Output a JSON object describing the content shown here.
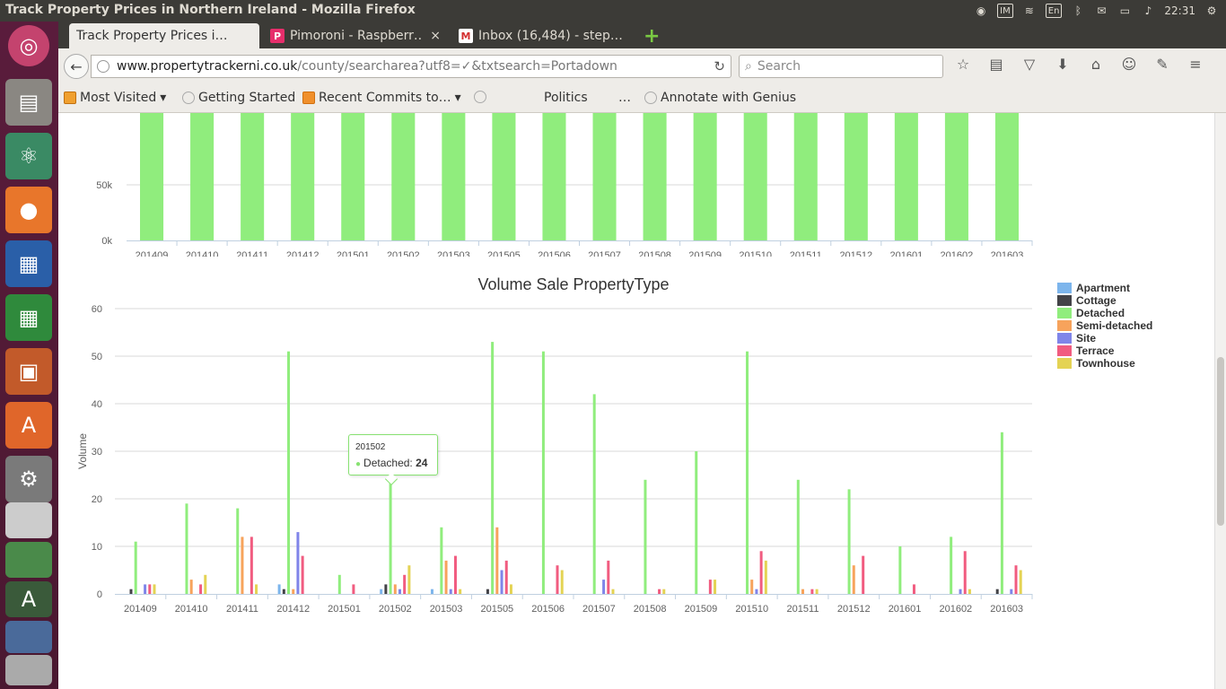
{
  "window": {
    "title": "Track Property Prices in Northern Ireland - Mozilla Firefox",
    "clock": "22:31",
    "keyboard_layout": "En"
  },
  "launcher": {
    "icons": [
      "ubuntu-icon",
      "files-icon",
      "atom-icon",
      "firefox-icon",
      "writer-icon",
      "calc-icon",
      "impress-icon",
      "software-center-icon",
      "settings-icon",
      "app-icon-1",
      "app-icon-2",
      "app-icon-3",
      "app-icon-4",
      "app-icon-5"
    ]
  },
  "tabs": [
    {
      "label": "Track Property Prices i…",
      "favicon": "",
      "active": true
    },
    {
      "label": "Pimoroni - Raspberr…",
      "favicon": "P",
      "active": false
    },
    {
      "label": "Inbox (16,484) - step…",
      "favicon": "M",
      "active": false
    }
  ],
  "navbar": {
    "url_domain": "www.propertytrackerni.co.uk",
    "url_path": "/county/searcharea?utf8=✓&txtsearch=Portadown",
    "search_placeholder": "Search"
  },
  "bookmarks": [
    {
      "label": "Most Visited",
      "dropdown": true
    },
    {
      "label": "Getting Started",
      "dropdown": false
    },
    {
      "label": "Recent Commits to…",
      "dropdown": true
    },
    {
      "label": "",
      "dropdown": false
    },
    {
      "label": "Politics",
      "dropdown": false
    },
    {
      "label": "…",
      "dropdown": false
    },
    {
      "label": "Annotate with Genius",
      "dropdown": false
    }
  ],
  "colors": {
    "Apartment": "#7cb5ec",
    "Cottage": "#434348",
    "Detached": "#90ed7d",
    "Semi-detached": "#f7a35c",
    "Site": "#8085e9",
    "Terrace": "#f15c80",
    "Townhouse": "#e4d354"
  },
  "chart_data": [
    {
      "type": "bar",
      "title": "",
      "categories": [
        "201409",
        "201410",
        "201411",
        "201412",
        "201501",
        "201502",
        "201503",
        "201505",
        "201506",
        "201507",
        "201508",
        "201509",
        "201510",
        "201511",
        "201512",
        "201601",
        "201602",
        "201603"
      ],
      "y_ticks": [
        "50k",
        "0k"
      ],
      "note_partial": "Upper chart scrolled out of view; bars extend above the visible area.",
      "series": [
        {
          "name": "",
          "color": "#90ed7d",
          "values": [
            null,
            null,
            null,
            null,
            null,
            null,
            null,
            null,
            null,
            null,
            null,
            null,
            null,
            null,
            null,
            null,
            null,
            null
          ]
        }
      ]
    },
    {
      "type": "bar",
      "title": "Volume Sale PropertyType",
      "ylabel": "Volume",
      "xlabel": "",
      "ylim": [
        0,
        60
      ],
      "y_ticks": [
        0,
        10,
        20,
        30,
        40,
        50,
        60
      ],
      "grid": true,
      "legend_position": "right",
      "categories": [
        "201409",
        "201410",
        "201411",
        "201412",
        "201501",
        "201502",
        "201503",
        "201505",
        "201506",
        "201507",
        "201508",
        "201509",
        "201510",
        "201511",
        "201512",
        "201601",
        "201602",
        "201603"
      ],
      "series": [
        {
          "name": "Apartment",
          "values": [
            0,
            0,
            0,
            2,
            0,
            1,
            1,
            0,
            0,
            0,
            0,
            0,
            0,
            0,
            0,
            0,
            0,
            0
          ]
        },
        {
          "name": "Cottage",
          "values": [
            1,
            0,
            0,
            1,
            0,
            2,
            0,
            1,
            0,
            0,
            0,
            0,
            0,
            0,
            0,
            0,
            0,
            1
          ]
        },
        {
          "name": "Detached",
          "values": [
            11,
            19,
            18,
            51,
            4,
            24,
            14,
            53,
            51,
            42,
            24,
            30,
            51,
            24,
            22,
            10,
            12,
            34
          ]
        },
        {
          "name": "Semi-detached",
          "values": [
            0,
            3,
            12,
            1,
            0,
            2,
            7,
            14,
            0,
            0,
            0,
            0,
            3,
            1,
            6,
            0,
            0,
            0
          ]
        },
        {
          "name": "Site",
          "values": [
            2,
            0,
            0,
            13,
            0,
            1,
            1,
            5,
            0,
            3,
            0,
            0,
            1,
            0,
            0,
            0,
            1,
            1
          ]
        },
        {
          "name": "Terrace",
          "values": [
            2,
            2,
            12,
            8,
            2,
            4,
            8,
            7,
            6,
            7,
            1,
            3,
            9,
            1,
            8,
            2,
            9,
            6
          ]
        },
        {
          "name": "Townhouse",
          "values": [
            2,
            4,
            2,
            0,
            0,
            6,
            1,
            2,
            5,
            1,
            1,
            3,
            7,
            1,
            0,
            0,
            1,
            5
          ]
        }
      ],
      "tooltip": {
        "category": "201502",
        "series": "Detached",
        "label": "Detached: ",
        "value": "24"
      }
    }
  ]
}
